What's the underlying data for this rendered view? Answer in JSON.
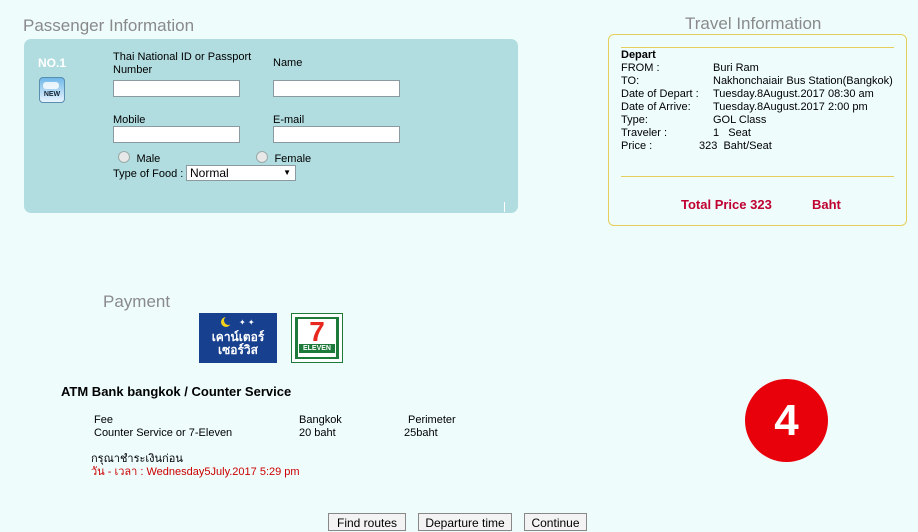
{
  "passenger": {
    "title": "Passenger Information",
    "number": "NO.1",
    "new_badge": "NEW",
    "id_label_line1": "Thai National ID or Passport",
    "id_label_line2": "Number",
    "name_label": "Name",
    "mobile_label": "Mobile",
    "email_label": "E-mail",
    "male_label": "Male",
    "female_label": "Female",
    "food_label": "Type of Food :",
    "food_value": "Normal"
  },
  "travel": {
    "title": "Travel Information",
    "heading": "Depart",
    "from_label": "FROM :",
    "from_value": "Buri Ram",
    "to_label": "TO:",
    "to_value": "Nakhonchaiair Bus Station(Bangkok)",
    "depart_label": "Date of Depart :",
    "depart_value": "Tuesday.8August.2017 08:30 am",
    "arrive_label": "Date of Arrive:",
    "arrive_value": "Tuesday.8August.2017 2:00 pm",
    "type_label": "Type:",
    "type_value": "GOL Class",
    "traveler_label": "Traveler :",
    "traveler_value": "1   Seat",
    "price_label": "Price :",
    "price_value": "323  Baht/Seat",
    "total_label": "Total Price 323",
    "total_unit": "Baht"
  },
  "payment": {
    "title": "Payment",
    "counter_logo_text": "เคาน์เตอร์ เซอร์วิส",
    "seven_logo_text": "ELEVEN",
    "method": "ATM Bank bangkok / Counter Service",
    "fee_col1": "Fee",
    "fee_col2": "Bangkok",
    "fee_col3": "Perimeter",
    "row_col1": "Counter Service or 7-Eleven",
    "row_col2": "20 baht",
    "row_col3": "25baht",
    "pay_before": "กรุณาชำระเงินก่อน",
    "deadline": "วัน - เวลา : Wednesday5July.2017 5:29 pm"
  },
  "step_number": "4",
  "buttons": {
    "find_routes": "Find routes",
    "departure_time": "Departure time",
    "continue": "Continue"
  },
  "colors": {
    "panel": "#b2dde0",
    "accent_red": "#c00030",
    "step_red": "#e8000a",
    "border_gold": "#e5cf5a"
  }
}
